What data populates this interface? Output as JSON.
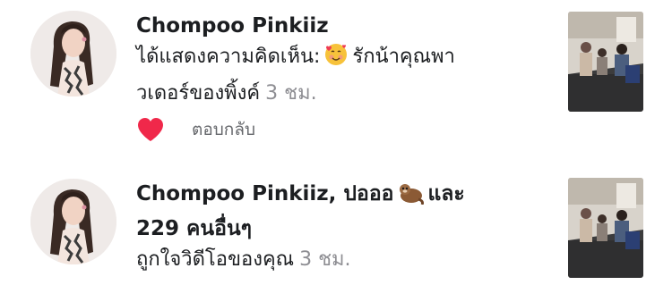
{
  "notifications": [
    {
      "actor": "Chompoo Pinkiiz",
      "text_before": "ได้แสดงความคิดเห็น:",
      "emoji_icon": "smiling-face-with-hearts-icon",
      "text_line1_after": "รักน้าคุณพา",
      "text_line2": "วเดอร์ของพิ้งค์",
      "time": "3 ชม.",
      "liked": true,
      "reply_label": "ตอบกลับ"
    },
    {
      "actor_line": "Chompoo Pinkiiz, ปอออ",
      "emoji_icon": "otter-icon",
      "and_word": "และ",
      "others_count": "229 คนอื่นๆ",
      "text": "ถูกใจวิดีโอของคุณ",
      "time": "3 ชม."
    }
  ],
  "colors": {
    "heart": "#f0284a",
    "time_gray": "#8e8e93"
  }
}
